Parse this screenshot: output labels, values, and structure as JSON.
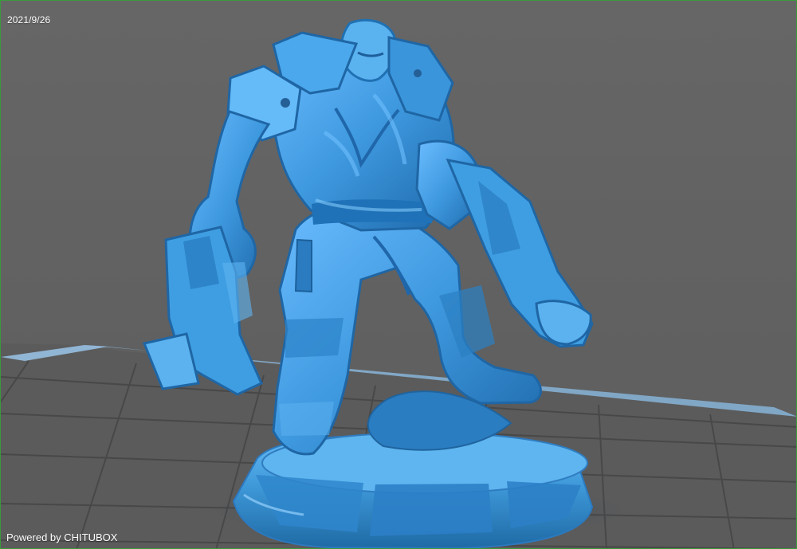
{
  "viewport": {
    "date": "2021/9/26",
    "brand_text": "Powered by CHITUBOX"
  },
  "scene": {
    "object": "model-figure-icon",
    "plate": "build-plate-grid-icon"
  },
  "colors": {
    "background": "#5f5f5f",
    "grid": "#4f4f4f",
    "model": "#4aa3e6",
    "model_dark": "#1f6fb3",
    "model_light": "#79c6ff",
    "plate_edge": "#5fb7f0",
    "border": "#3a9b3a"
  }
}
